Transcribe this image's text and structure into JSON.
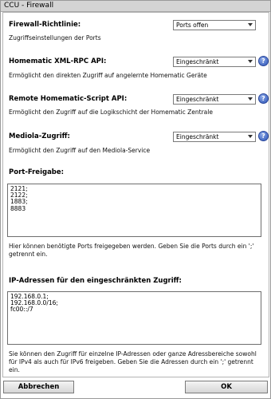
{
  "window": {
    "title": "CCU - Firewall"
  },
  "sections": {
    "firewall": {
      "label": "Firewall-Richtlinie:",
      "value": "Ports offen",
      "description": "Zugriffseinstellungen der Ports"
    },
    "xmlrpc": {
      "label": "Homematic XML-RPC API:",
      "value": "Eingeschränkt",
      "description": "Ermöglicht den direkten Zugriff auf angelernte Homematic Geräte"
    },
    "script": {
      "label": "Remote Homematic-Script API:",
      "value": "Eingeschränkt",
      "description": "Ermöglicht den Zugriff auf die Logikschicht der Homematic Zentrale"
    },
    "mediola": {
      "label": "Mediola-Zugriff:",
      "value": "Eingeschränkt",
      "description": "Ermöglicht den Zugriff auf den Mediola-Service"
    },
    "ports": {
      "label": "Port-Freigabe:",
      "lines": [
        "2121;",
        "2122;",
        "1883;",
        "8883"
      ],
      "description": "Hier können benötigte Ports freigegeben werden. Geben Sie die Ports durch ein ';' getrennt ein."
    },
    "ips": {
      "label": "IP-Adressen für den eingeschränkten Zugriff:",
      "lines": [
        "192.168.0.1;",
        "192.168.0.0/16;",
        "fc00::/7"
      ],
      "description": "Sie können den Zugriff für einzelne IP-Adressen oder ganze Adressbereiche sowohl für IPv4 als auch für IPv6 freigeben. Geben Sie die Adressen durch ein ';' getrennt ein."
    }
  },
  "help_glyph": "?",
  "buttons": {
    "cancel": "Abbrechen",
    "ok": "OK"
  }
}
